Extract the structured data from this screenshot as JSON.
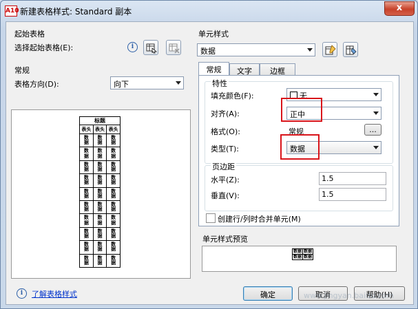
{
  "window": {
    "title": "新建表格样式: Standard 副本",
    "app_icon": "A10",
    "close_glyph": "x"
  },
  "starting_table": {
    "group_label": "起始表格",
    "select_label": "选择起始表格(E):"
  },
  "general": {
    "group_label": "常规",
    "direction_label": "表格方向(D):",
    "direction_value": "向下"
  },
  "preview": {
    "title_cell": "标题",
    "header_cells": [
      "表头",
      "表头",
      "表头"
    ],
    "data_cell": "数据",
    "data_rows": 10
  },
  "cell_style": {
    "group_label": "单元样式",
    "selected": "数据",
    "tabs": [
      {
        "label": "常规"
      },
      {
        "label": "文字"
      },
      {
        "label": "边框"
      }
    ],
    "properties": {
      "group_label": "特性",
      "fill_label": "填充颜色(F):",
      "fill_value": "无",
      "align_label": "对齐(A):",
      "align_value": "正中",
      "format_label": "格式(O):",
      "format_value": "常规",
      "format_button": "...",
      "type_label": "类型(T):",
      "type_value": "数据"
    },
    "margins": {
      "group_label": "页边距",
      "horizontal_label": "水平(Z):",
      "horizontal_value": "1.5",
      "vertical_label": "垂直(V):",
      "vertical_value": "1.5"
    },
    "merge_label": "创建行/列时合并单元(M)",
    "preview_label": "单元样式预览",
    "mini_preview_cell": "数据"
  },
  "footer": {
    "help_link": "了解表格样式",
    "ok": "确定",
    "cancel": "取消",
    "help": "帮助(H)"
  },
  "watermark": "www.jingyan.baidu.com"
}
